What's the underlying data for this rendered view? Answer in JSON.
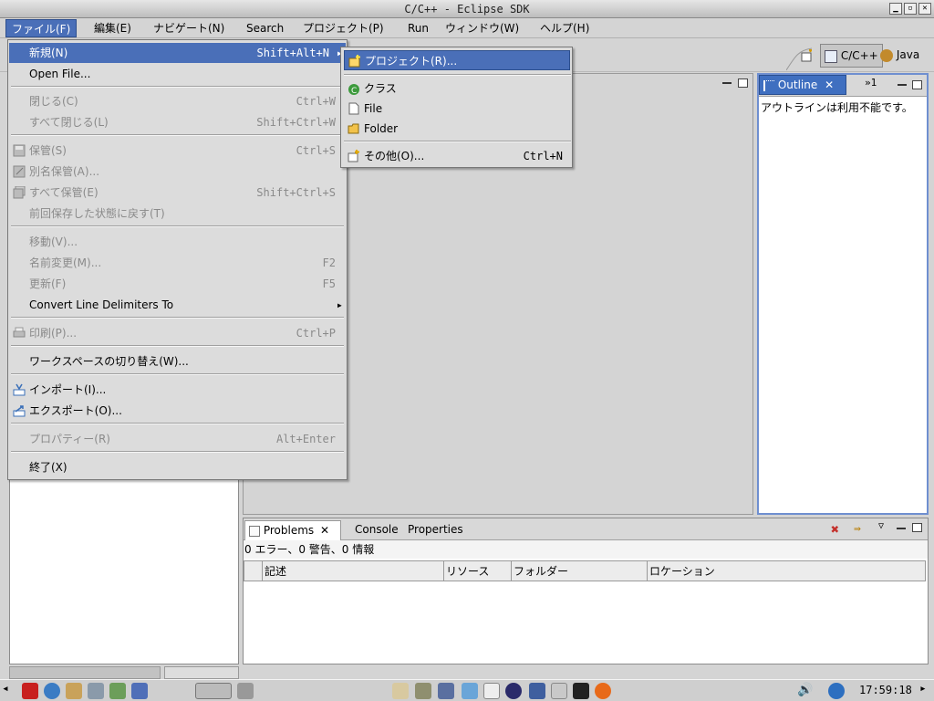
{
  "window": {
    "title": "C/C++ - Eclipse SDK"
  },
  "menubar": [
    {
      "label": "ファイル(F)",
      "active": true
    },
    {
      "label": "編集(E)"
    },
    {
      "label": "ナビゲート(N)"
    },
    {
      "label": "Search"
    },
    {
      "label": "プロジェクト(P)"
    },
    {
      "label": "Run"
    },
    {
      "label": "ウィンドウ(W)"
    },
    {
      "label": "ヘルプ(H)"
    }
  ],
  "perspectives": [
    {
      "label": "C/C++",
      "selected": true
    },
    {
      "label": "Java"
    }
  ],
  "file_menu": [
    {
      "label": "新規(N)",
      "accel": "Shift+Alt+N",
      "highlight": true,
      "submenu": true
    },
    {
      "label": "Open File..."
    },
    {
      "label": "閉じる(C)",
      "accel": "Ctrl+W",
      "disabled": true
    },
    {
      "label": "すべて閉じる(L)",
      "accel": "Shift+Ctrl+W",
      "disabled": true
    },
    {
      "label": "保管(S)",
      "accel": "Ctrl+S",
      "disabled": true,
      "icon": "save-icon"
    },
    {
      "label": "別名保管(A)...",
      "disabled": true,
      "icon": "save-as-icon"
    },
    {
      "label": "すべて保管(E)",
      "accel": "Shift+Ctrl+S",
      "disabled": true,
      "icon": "save-all-icon"
    },
    {
      "label": "前回保存した状態に戻す(T)",
      "disabled": true
    },
    {
      "label": "移動(V)...",
      "disabled": true
    },
    {
      "label": "名前変更(M)...",
      "accel": "F2",
      "disabled": true
    },
    {
      "label": "更新(F)",
      "accel": "F5",
      "disabled": true
    },
    {
      "label": "Convert Line Delimiters To",
      "submenu": true
    },
    {
      "label": "印刷(P)...",
      "accel": "Ctrl+P",
      "disabled": true,
      "icon": "print-icon"
    },
    {
      "label": "ワークスペースの切り替え(W)..."
    },
    {
      "label": "インポート(I)...",
      "icon": "import-icon"
    },
    {
      "label": "エクスポート(O)...",
      "icon": "export-icon"
    },
    {
      "label": "プロパティー(R)",
      "accel": "Alt+Enter",
      "disabled": true
    },
    {
      "label": "終了(X)"
    }
  ],
  "new_submenu": [
    {
      "label": "プロジェクト(R)...",
      "highlight": true,
      "icon": "new-project-icon"
    },
    {
      "label": "クラス",
      "icon": "new-class-icon"
    },
    {
      "label": "File",
      "icon": "new-file-icon"
    },
    {
      "label": "Folder",
      "icon": "new-folder-icon"
    },
    {
      "label": "その他(O)...",
      "accel": "Ctrl+N",
      "icon": "new-other-icon"
    }
  ],
  "outline": {
    "tab_label": "Outline",
    "message": "アウトラインは利用不能です。",
    "overflow_count": "1"
  },
  "problems": {
    "tabs": [
      "Problems",
      "Console",
      "Properties"
    ],
    "summary": "0 エラー、0 警告、0 情報",
    "columns": [
      "記述",
      "リソース",
      "フォルダー",
      "ロケーション"
    ]
  },
  "taskbar": {
    "clock": "17:59:18"
  },
  "colors": {
    "highlight": "#4a6fb8",
    "menu_bg": "#dcdcdc",
    "chrome": "#d4d4d4"
  }
}
